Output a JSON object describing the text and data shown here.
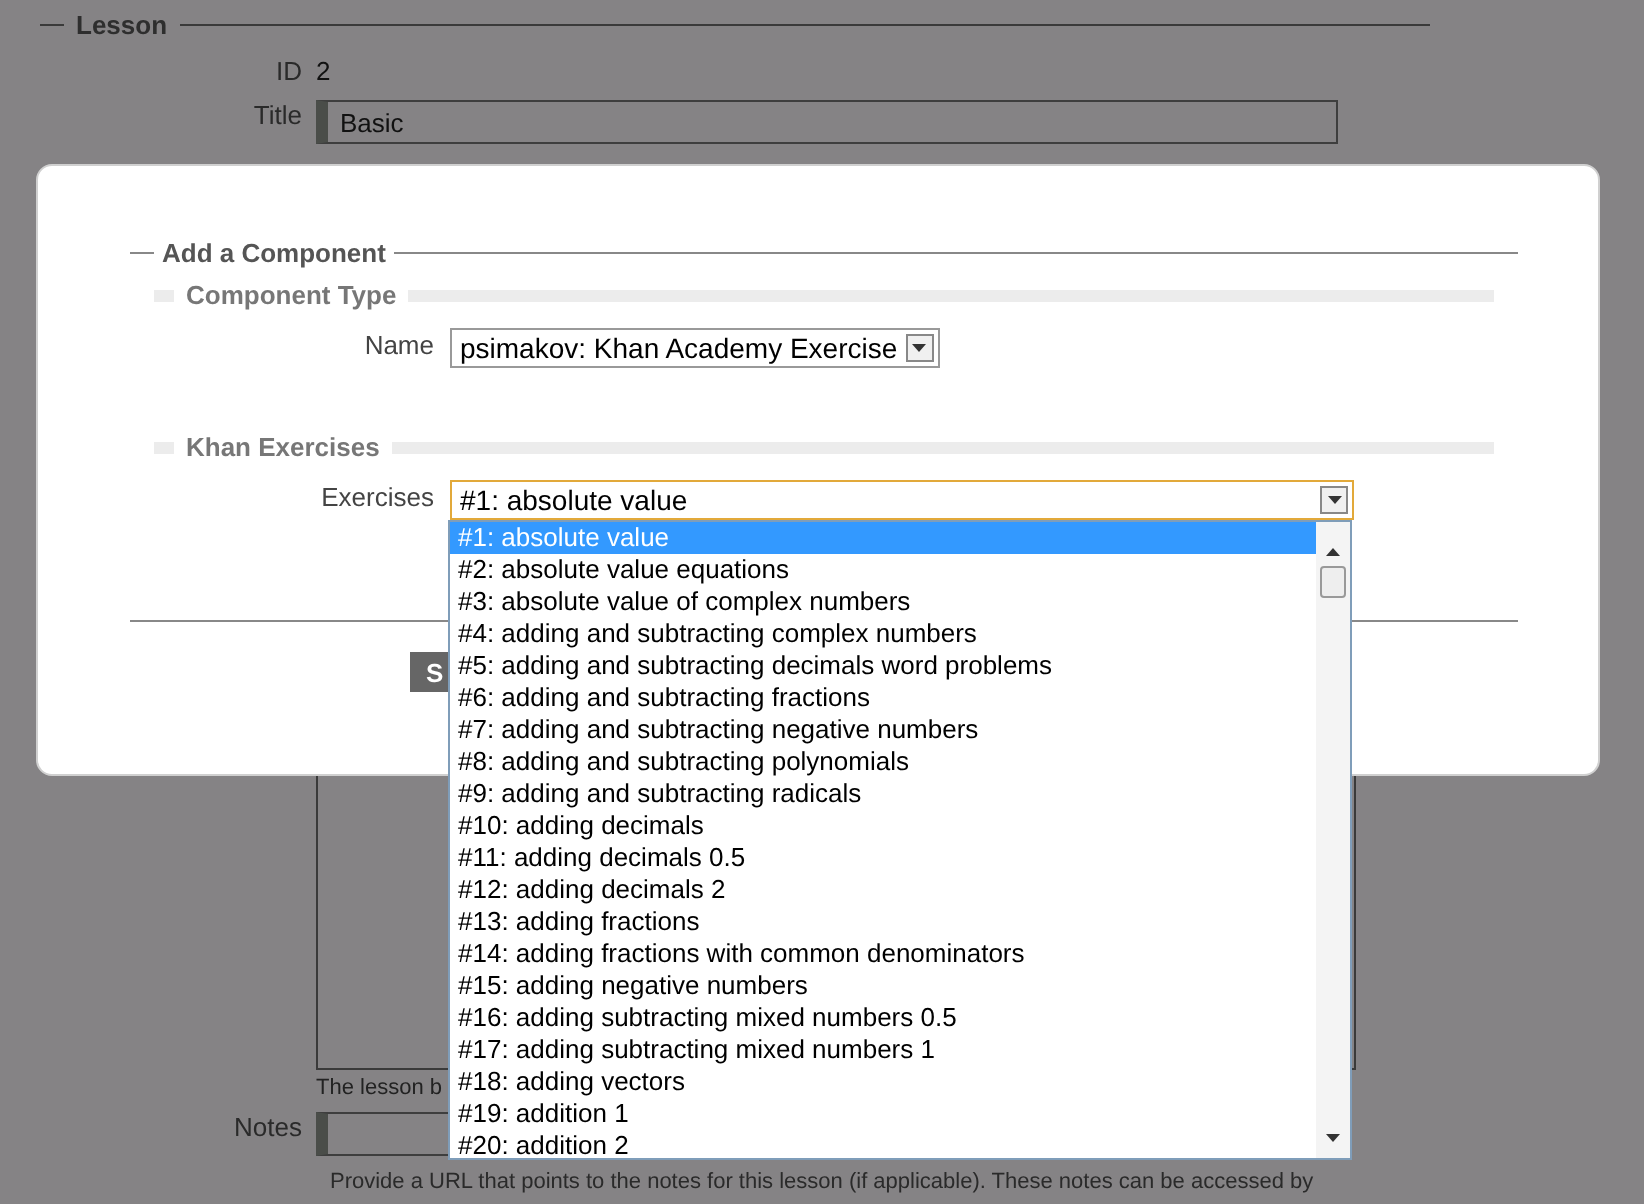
{
  "lesson": {
    "legend": "Lesson",
    "id_label": "ID",
    "id_value": "2",
    "title_label": "Title",
    "title_value": "Basic",
    "body_hint": "The lesson b",
    "notes_label": "Notes",
    "notes_help": "Provide a URL that points to the notes for this lesson (if applicable). These notes can be accessed by"
  },
  "dialog": {
    "legend": "Add a Component",
    "component_type": {
      "legend": "Component Type",
      "name_label": "Name",
      "name_value": "psimakov: Khan Academy Exercise"
    },
    "khan_exercises": {
      "legend": "Khan Exercises",
      "exercises_label": "Exercises",
      "exercises_value": "#1: absolute value",
      "expanded": true,
      "options": [
        {
          "label": "#1: absolute value",
          "selected": true
        },
        {
          "label": "#2: absolute value equations",
          "selected": false
        },
        {
          "label": "#3: absolute value of complex numbers",
          "selected": false
        },
        {
          "label": "#4: adding and subtracting complex numbers",
          "selected": false
        },
        {
          "label": "#5: adding and subtracting decimals word problems",
          "selected": false
        },
        {
          "label": "#6: adding and subtracting fractions",
          "selected": false
        },
        {
          "label": "#7: adding and subtracting negative numbers",
          "selected": false
        },
        {
          "label": "#8: adding and subtracting polynomials",
          "selected": false
        },
        {
          "label": "#9: adding and subtracting radicals",
          "selected": false
        },
        {
          "label": "#10: adding decimals",
          "selected": false
        },
        {
          "label": "#11: adding decimals 0.5",
          "selected": false
        },
        {
          "label": "#12: adding decimals 2",
          "selected": false
        },
        {
          "label": "#13: adding fractions",
          "selected": false
        },
        {
          "label": "#14: adding fractions with common denominators",
          "selected": false
        },
        {
          "label": "#15: adding negative numbers",
          "selected": false
        },
        {
          "label": "#16: adding subtracting mixed numbers 0.5",
          "selected": false
        },
        {
          "label": "#17: adding subtracting mixed numbers 1",
          "selected": false
        },
        {
          "label": "#18: adding vectors",
          "selected": false
        },
        {
          "label": "#19: addition 1",
          "selected": false
        },
        {
          "label": "#20: addition 2",
          "selected": false
        }
      ]
    },
    "button": "S"
  }
}
